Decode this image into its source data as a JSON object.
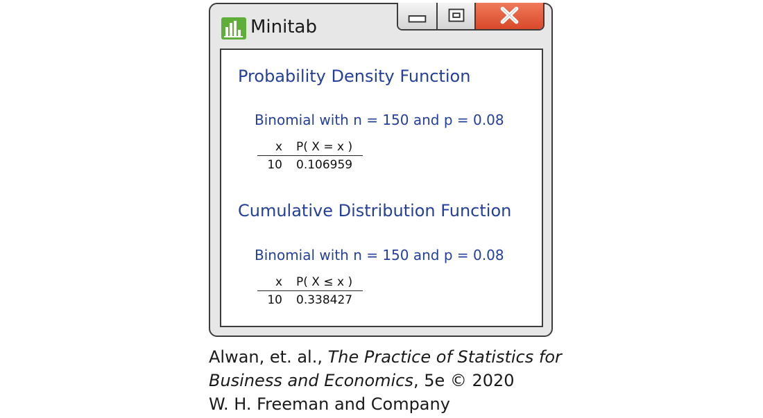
{
  "window": {
    "title": "Minitab",
    "icon": "minitab-bar-chart-icon",
    "controls": [
      "minimize-icon",
      "maximize-icon",
      "close-icon"
    ],
    "colors": {
      "close_button": "#e05a3a",
      "heading_text": "#24409a",
      "icon_green": "#5fae3a"
    }
  },
  "pdf": {
    "heading": "Probability Density Function",
    "subheading": "Binomial with n = 150 and p = 0.08",
    "col_x": "x",
    "col_p": "P( X = x )",
    "row_x": "10",
    "row_p": "0.106959"
  },
  "cdf": {
    "heading": "Cumulative Distribution Function",
    "subheading": "Binomial with n = 150 and p = 0.08",
    "col_x": "x",
    "col_p": "P( X ≤ x )",
    "row_x": "10",
    "row_p": "0.338427"
  },
  "caption": {
    "line1_plain": "Alwan, et. al., ",
    "line1_italic": "The Practice of Statistics for",
    "line2_italic": "Business and Economics",
    "line2_plain": ", 5e © 2020",
    "line3": "W. H. Freeman and Company"
  }
}
